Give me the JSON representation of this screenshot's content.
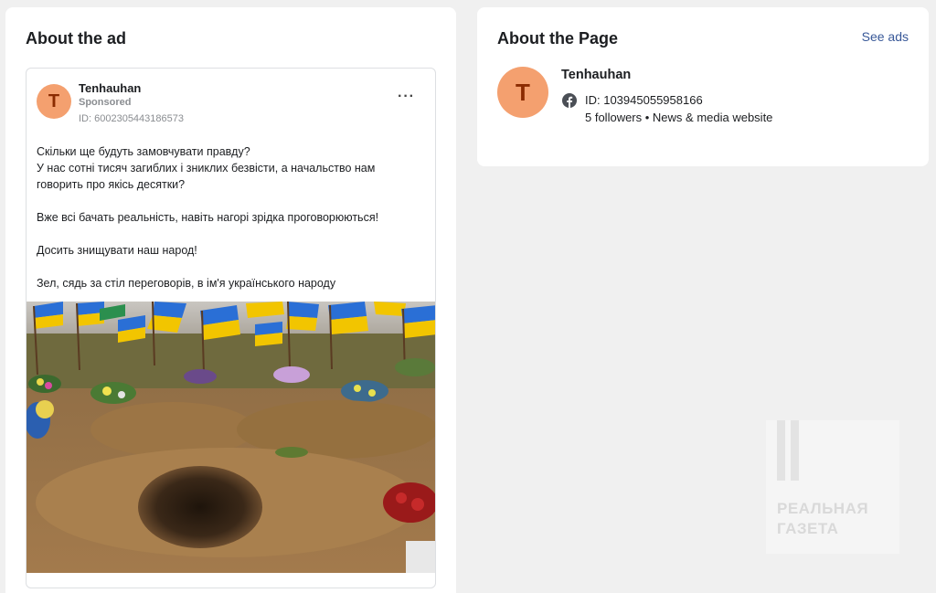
{
  "about_ad": {
    "title": "About the ad",
    "preview": {
      "avatar_letter": "T",
      "page_name": "Tenhauhan",
      "sponsored": "Sponsored",
      "id_text": "ID: 6002305443186573",
      "more_label": "···",
      "text_lines": [
        "Скільки ще будуть замовчувати правду?",
        "У нас сотні тисяч загиблих і зниклих безвісти, а начальство нам",
        "говорить про якісь десятки?",
        "",
        "Вже всі бачать реальність, навіть нагорі зрідка проговорюються!",
        "",
        "Досить знищувати наш народ!",
        "",
        "Зел, сядь за стіл переговорів, в ім'я українського народу"
      ]
    }
  },
  "about_page": {
    "title": "About the Page",
    "see_ads": "See ads",
    "avatar_letter": "T",
    "page_name": "Tenhauhan",
    "id_text": "ID: 103945055958166",
    "meta_text": "5 followers • News & media website",
    "icon": "facebook-icon"
  },
  "watermark": {
    "line1": "РЕАЛЬНАЯ",
    "line2": "ГАЗЕТА"
  },
  "colors": {
    "background": "#f0f0f0",
    "card": "#ffffff",
    "avatar": "#f4a06f",
    "avatar_letter": "#8b2b00",
    "link": "#385898",
    "muted": "#8a8d91"
  }
}
